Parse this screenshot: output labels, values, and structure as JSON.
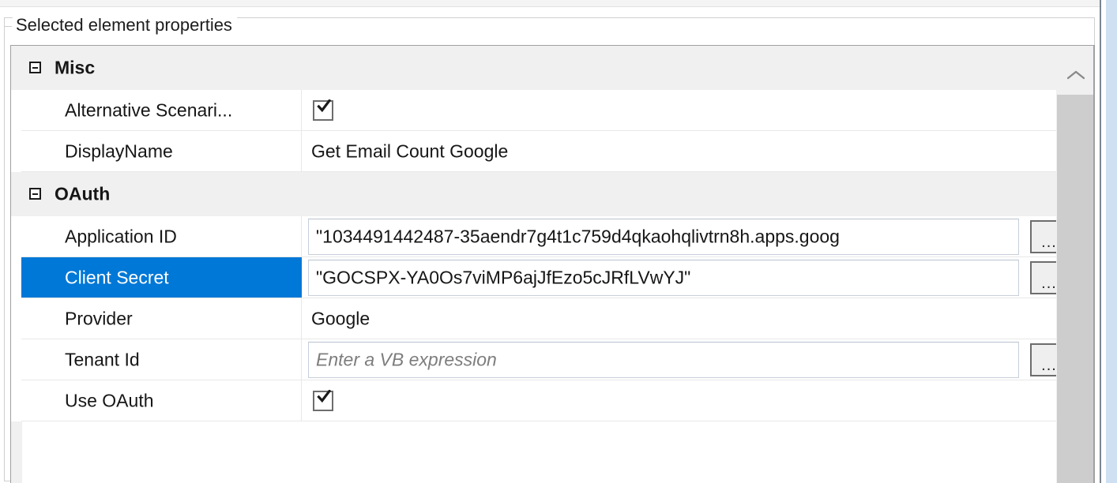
{
  "groupbox": {
    "legend": "Selected element properties"
  },
  "grid": {
    "sections": [
      {
        "name": "Misc",
        "expander_icon": "collapse-minus-icon",
        "rows": [
          {
            "label": "Alternative Scenari...",
            "type": "checkbox",
            "checked": true,
            "selected": false
          },
          {
            "label": "DisplayName",
            "type": "text",
            "value": "Get Email Count Google",
            "selected": false
          }
        ]
      },
      {
        "name": "OAuth",
        "expander_icon": "collapse-minus-icon",
        "rows": [
          {
            "label": "Application ID",
            "type": "editor",
            "value": "\"1034491442487-35aendr7g4t1c759d4qkaohqlivtrn8h.apps.goog",
            "has_ellipsis_button": true,
            "ellipsis_label": "...",
            "selected": false
          },
          {
            "label": "Client Secret",
            "type": "editor",
            "value": "\"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\"",
            "has_ellipsis_button": true,
            "ellipsis_label": "...",
            "selected": true
          },
          {
            "label": "Provider",
            "type": "text",
            "value": "Google",
            "selected": false
          },
          {
            "label": "Tenant Id",
            "type": "editor",
            "value": "",
            "placeholder": "Enter a VB expression",
            "has_ellipsis_button": true,
            "ellipsis_label": "...",
            "selected": false
          },
          {
            "label": "Use OAuth",
            "type": "checkbox",
            "checked": true,
            "selected": false
          }
        ]
      }
    ]
  },
  "scrollbar": {
    "up_icon": "chevron-up-icon"
  },
  "colors": {
    "selection_blue": "#0078d7",
    "category_background": "#f0f0f0",
    "scroll_thumb": "#cdcdcd"
  }
}
